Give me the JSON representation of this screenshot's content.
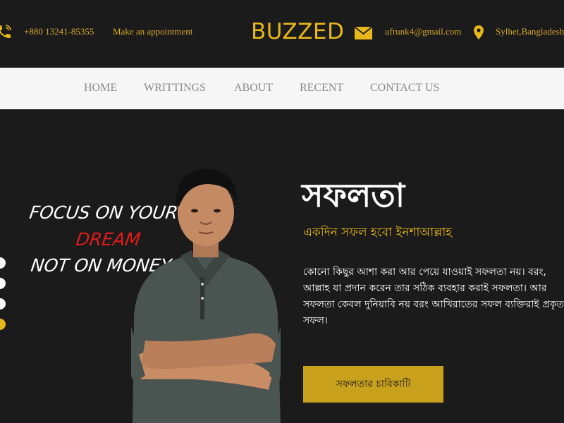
{
  "topbar": {
    "phone": "+880 13241-85355",
    "appointment": "Make an appointment",
    "brand": "BUZZED",
    "email": "ufrunk4@gmail.com",
    "location": "Sylhet,Bangladesh",
    "icons": {
      "phone": "phone-icon",
      "mail": "mail-icon",
      "location": "location-pin-icon"
    }
  },
  "nav": {
    "items": [
      {
        "label": "HOME"
      },
      {
        "label": "WRITTINGS"
      },
      {
        "label": "ABOUT"
      },
      {
        "label": "RECENT"
      },
      {
        "label": "CONTACT US"
      }
    ]
  },
  "hero": {
    "quote": {
      "line1": "FOCUS ON YOUR",
      "line2": "DREAM",
      "line3": "NOT ON MONEY"
    },
    "title": "সফলতা",
    "subtitle": "একদিন সফল হবো ইনশাআল্লাহ",
    "paragraph_lines": [
      "কোনো কিছুর আশা করা আর পেয়ে যাওয়াই সফলতা নয়। বরং,",
      "আল্লাহ যা প্রদান করেন তার সঠিক ব্যবহার করাই সফলতা। আর",
      "সফলতা কেবল দুনিয়াবি নয় বরং আখিরাতের সফল ব্যক্তিরাই প্রকৃত",
      "সফল।"
    ],
    "cta_label": "সফলতার চাবিকাটি",
    "slider_dots_count": 4,
    "slider_active_index": 3
  },
  "colors": {
    "background": "#1b1b1b",
    "accent": "#e8b719",
    "accent_text": "#d4a82c",
    "button": "#c9a11c",
    "nav_bg": "#f6f6f6",
    "nav_text": "#8a8a8a",
    "quote_red": "#e01b1b"
  }
}
